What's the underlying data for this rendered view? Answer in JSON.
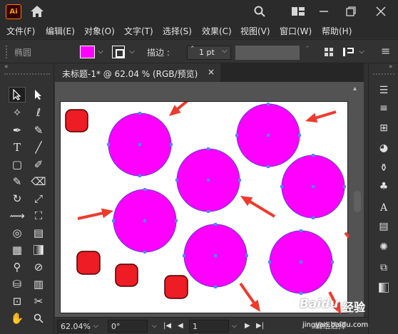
{
  "app": {
    "logo_text": "Ai"
  },
  "menubar": {
    "items": [
      {
        "label": "文件(F)"
      },
      {
        "label": "编辑(E)"
      },
      {
        "label": "对象(O)"
      },
      {
        "label": "文字(T)"
      },
      {
        "label": "选择(S)"
      },
      {
        "label": "效果(C)"
      },
      {
        "label": "视图(V)"
      },
      {
        "label": "窗口(W)"
      },
      {
        "label": "帮助(H)"
      }
    ]
  },
  "controlbar": {
    "object_type": "椭圆",
    "fill_color": "#ff00ff",
    "stroke_label": "描边 :",
    "stroke_value": "1 pt"
  },
  "document": {
    "tab_title": "未标题-1* @ 62.04 % (RGB/预览)",
    "close_glyph": "×"
  },
  "statusbar": {
    "zoom": "62.04%",
    "rotation": "0°",
    "artboard_number": "1",
    "mode_hint": "编组选择"
  },
  "artwork": {
    "circle_fill": "#ff00ff",
    "circle_stroke": "#5a3fd6",
    "square_fill": "#ee1c24",
    "arrow_color": "#ee3a2c",
    "selection_color": "#4a8cff"
  },
  "watermark": {
    "brand": "Baidu",
    "brand_suffix": "经验",
    "url": "jingyan.baidu.com"
  }
}
